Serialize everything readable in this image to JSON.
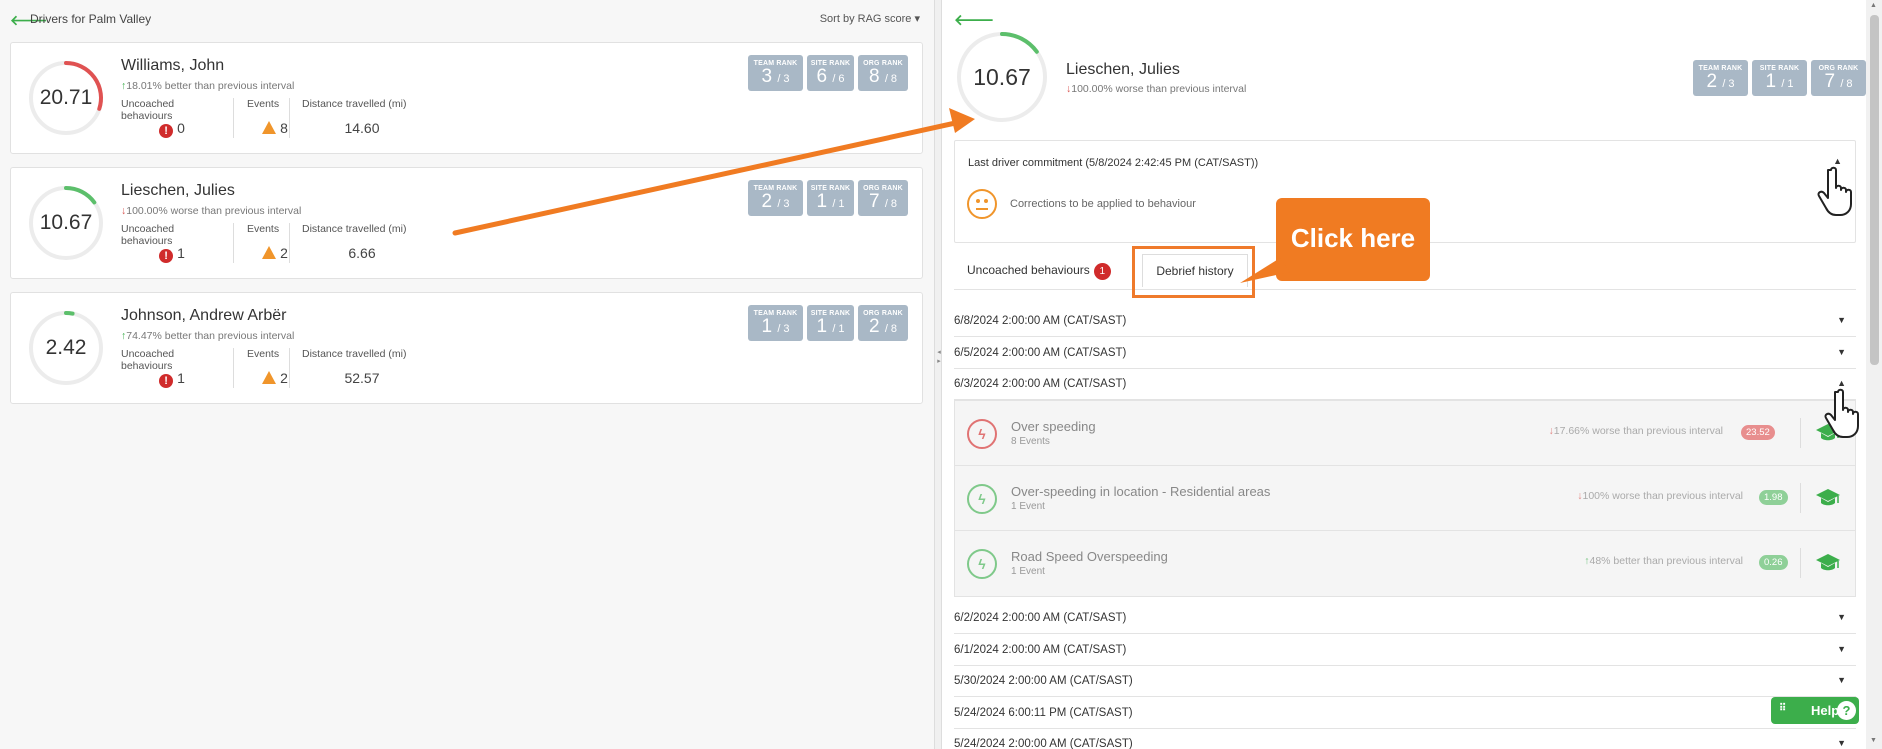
{
  "left_panel": {
    "title": "Drivers for Palm Valley",
    "sort_label": "Sort by RAG score ▾",
    "stat_labels": {
      "uncoached": "Uncoached behaviours",
      "events": "Events",
      "distance": "Distance travelled (mi)"
    },
    "rank_labels": {
      "team": "TEAM RANK",
      "site": "SITE RANK",
      "org": "ORG RANK"
    },
    "drivers": [
      {
        "name": "Williams, John",
        "score": "20.71",
        "score_fraction": 0.3,
        "gauge_color": "#e05252",
        "trend_dir": "up",
        "trend": "18.01% better than previous interval",
        "uncoached": "0",
        "events": "8",
        "distance": "14.60",
        "team_rank": "3",
        "team_total": "/ 3",
        "site_rank": "6",
        "site_total": "/ 6",
        "org_rank": "8",
        "org_total": "/ 8"
      },
      {
        "name": "Lieschen, Julies",
        "score": "10.67",
        "score_fraction": 0.15,
        "gauge_color": "#5cbf6b",
        "trend_dir": "down",
        "trend": "100.00% worse than previous interval",
        "uncoached": "1",
        "events": "2",
        "distance": "6.66",
        "team_rank": "2",
        "team_total": "/ 3",
        "site_rank": "1",
        "site_total": "/ 1",
        "org_rank": "7",
        "org_total": "/ 8"
      },
      {
        "name": "Johnson, Andrew Arbër",
        "score": "2.42",
        "score_fraction": 0.03,
        "gauge_color": "#5cbf6b",
        "trend_dir": "up",
        "trend": "74.47% better than previous interval",
        "uncoached": "1",
        "events": "2",
        "distance": "52.57",
        "team_rank": "1",
        "team_total": "/ 3",
        "site_rank": "1",
        "site_total": "/ 1",
        "org_rank": "2",
        "org_total": "/ 8"
      }
    ]
  },
  "detail_panel": {
    "score": "10.67",
    "score_fraction": 0.15,
    "name": "Lieschen, Julies",
    "trend": "100.00% worse than previous interval",
    "team_rank": "2",
    "team_total": "/ 3",
    "site_rank": "1",
    "site_total": "/ 1",
    "org_rank": "7",
    "org_total": "/ 8",
    "commitment_title": "Last driver commitment (5/8/2024 2:42:45 PM (CAT/SAST))",
    "commitment_text": "Corrections to be applied to behaviour",
    "tab_uncoached": "Uncoached behaviours",
    "tab_uncoached_count": "1",
    "tab_debrief": "Debrief history",
    "dates_top": [
      "6/8/2024 2:00:00 AM (CAT/SAST)",
      "6/5/2024 2:00:00 AM (CAT/SAST)",
      "6/3/2024 2:00:00 AM (CAT/SAST)"
    ],
    "behaviours": [
      {
        "name": "Over speeding",
        "sub": "8 Events",
        "trend_dir": "down",
        "trend": "17.66% worse than previous interval",
        "value": "23.52",
        "color": "red"
      },
      {
        "name": "Over-speeding in location - Residential areas",
        "sub": "1 Event",
        "trend_dir": "down",
        "trend": "100% worse than previous interval",
        "value": "1.98",
        "color": "green"
      },
      {
        "name": "Road Speed Overspeeding",
        "sub": "1 Event",
        "trend_dir": "up",
        "trend": "48% better than previous interval",
        "value": "0.26",
        "color": "green"
      }
    ],
    "dates_bottom": [
      "6/2/2024 2:00:00 AM (CAT/SAST)",
      "6/1/2024 2:00:00 AM (CAT/SAST)",
      "5/30/2024 2:00:00 AM (CAT/SAST)",
      "5/24/2024 6:00:11 PM (CAT/SAST)",
      "5/24/2024 2:00:00 AM (CAT/SAST)"
    ]
  },
  "callout_text": "Click here",
  "help_label": "Help",
  "icons": [
    "back-arrow-icon",
    "error-icon",
    "warning-icon",
    "neutral-face-icon",
    "lightning-bolt-icon",
    "graduation-cap-icon",
    "hand-cursor-icon",
    "help-icon"
  ],
  "colors": {
    "accent_green": "#3cae4b",
    "error_red": "#d02b2b",
    "warning_orange": "#f0952b",
    "annotation_orange": "#f07b22",
    "rank_bg": "#a9b8c6"
  }
}
